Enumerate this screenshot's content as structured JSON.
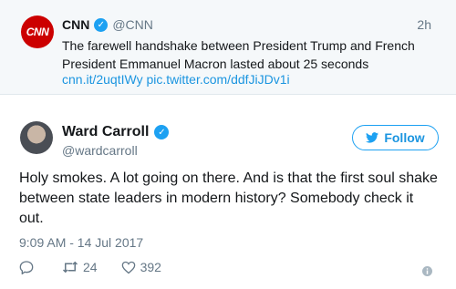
{
  "quoted": {
    "avatar_text": "CNN",
    "name": "CNN",
    "handle": "@CNN",
    "time": "2h",
    "text": "The farewell handshake between President Trump and French President Emmanuel Macron lasted about 25 seconds",
    "link1": "cnn.it/2uqtIWy",
    "link2": "pic.twitter.com/ddfJiJDv1i"
  },
  "tweet": {
    "name": "Ward Carroll",
    "handle": "@wardcarroll",
    "follow_label": "Follow",
    "text": "Holy smokes. A lot going on there. And is that the first soul shake between state leaders in modern history? Somebody check it out.",
    "timestamp": "9:09 AM - 14 Jul 2017",
    "retweets": "24",
    "likes": "392"
  },
  "colors": {
    "accent": "#1da1f2",
    "link": "#1b95e0",
    "muted": "#657786",
    "cnn_red": "#cc0000"
  },
  "icons": [
    "reply-icon",
    "retweet-icon",
    "heart-icon",
    "info-icon",
    "verified-icon",
    "twitter-bird-icon"
  ]
}
